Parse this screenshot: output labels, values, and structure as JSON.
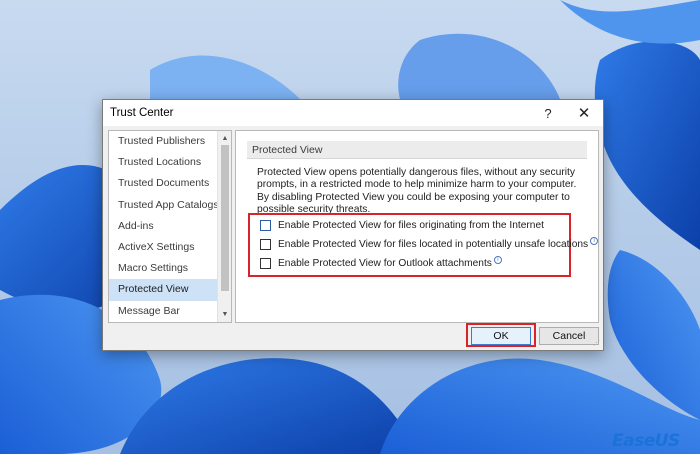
{
  "window": {
    "title": "Trust Center",
    "help_glyph": "?",
    "close_glyph": "✕"
  },
  "nav": {
    "items": [
      {
        "label": "Trusted Publishers"
      },
      {
        "label": "Trusted Locations"
      },
      {
        "label": "Trusted Documents"
      },
      {
        "label": "Trusted App Catalogs"
      },
      {
        "label": "Add-ins"
      },
      {
        "label": "ActiveX Settings"
      },
      {
        "label": "Macro Settings"
      },
      {
        "label": "Protected View"
      },
      {
        "label": "Message Bar"
      }
    ],
    "selected": "Protected View"
  },
  "content": {
    "section_title": "Protected View",
    "description": "Protected View opens potentially dangerous files, without any security prompts, in a restricted mode to help minimize harm to your computer. By disabling Protected View you could be exposing your computer to possible security threats.",
    "options": [
      {
        "label": "Enable Protected View for files originating from the Internet",
        "checked": false,
        "info": false
      },
      {
        "label": "Enable Protected View for files located in potentially unsafe locations",
        "checked": false,
        "info": true
      },
      {
        "label": "Enable Protected View for Outlook attachments",
        "checked": false,
        "info": true
      }
    ]
  },
  "buttons": {
    "ok": "OK",
    "cancel": "Cancel"
  },
  "branding": {
    "logo_text": "EaseUS"
  },
  "colors": {
    "highlight_red": "#d9232b",
    "selection_blue": "#cde1f7",
    "logo_blue": "#1a73d9"
  }
}
